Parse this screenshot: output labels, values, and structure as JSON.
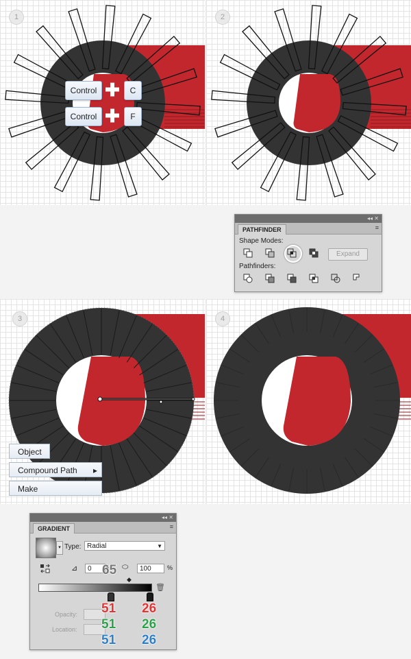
{
  "steps": [
    "1",
    "2",
    "3",
    "4"
  ],
  "shortcuts": {
    "key_control_1": "Control",
    "key_c": "C",
    "key_control_2": "Control",
    "key_f": "F",
    "plus": "✚"
  },
  "pathfinder": {
    "title": "PATHFINDER",
    "shape_modes_label": "Shape Modes:",
    "expand_label": "Expand",
    "pathfinders_label": "Pathfinders:",
    "panel_controls": "◂◂ ✕",
    "menu_icon": "≡"
  },
  "context_menu": {
    "item_object": "Object",
    "item_compound_path": "Compound Path",
    "item_make": "Make",
    "arrow": "▸"
  },
  "gradient": {
    "title": "GRADIENT",
    "type_label": "Type:",
    "type_value": "Radial",
    "angle_value": "0",
    "aspect_value": "100",
    "percent": "%",
    "opacity_label": "Opacity:",
    "location_label": "Location:",
    "panel_controls": "◂◂ ✕",
    "menu_icon": "≡",
    "annotation_65": "65",
    "left_stop": {
      "r": "51",
      "g": "51",
      "b": "51"
    },
    "right_stop": {
      "r": "26",
      "g": "26",
      "b": "26"
    }
  },
  "colors": {
    "ring_dark": "#333333",
    "red": "#c1272d",
    "annot_red": "#e03535",
    "annot_green": "#2ea04a",
    "annot_blue": "#2f7fc8"
  }
}
